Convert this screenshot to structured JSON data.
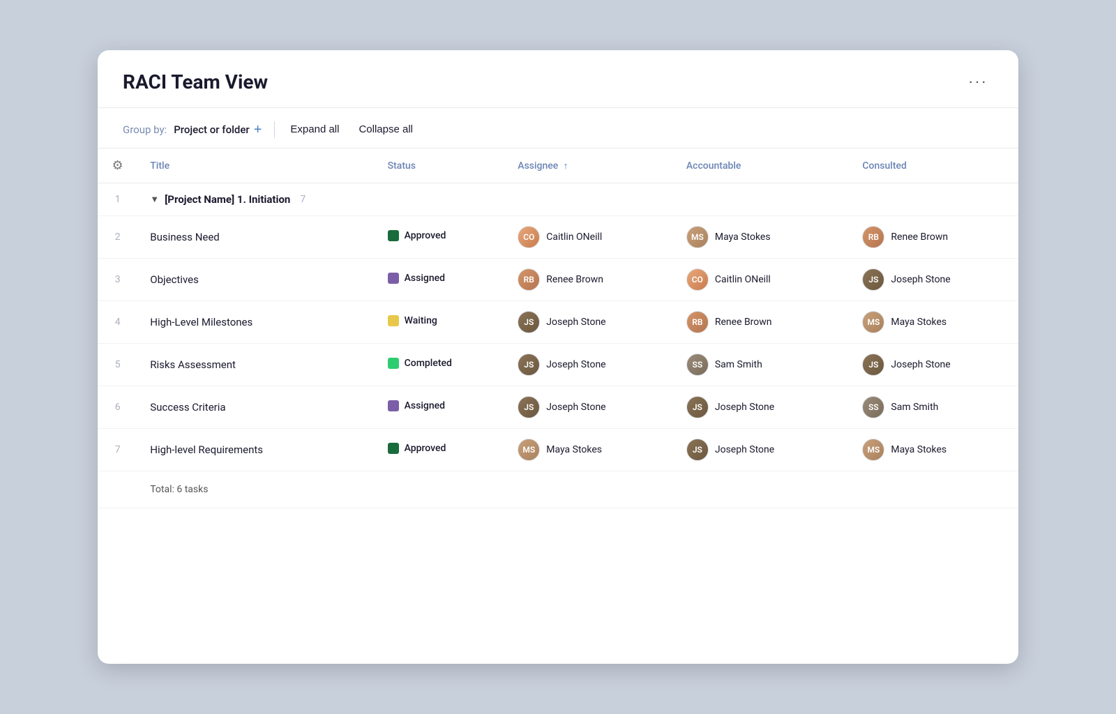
{
  "header": {
    "title": "RACI Team View",
    "more_label": "···"
  },
  "toolbar": {
    "group_by_label": "Group by:",
    "group_by_value": "Project or folder",
    "add_icon": "+",
    "expand_all": "Expand all",
    "collapse_all": "Collapse all"
  },
  "columns": {
    "title": "Title",
    "status": "Status",
    "assignee": "Assignee",
    "accountable": "Accountable",
    "consulted": "Consulted"
  },
  "group": {
    "label": "[Project Name] 1. Initiation",
    "count": "7",
    "chevron": "▼"
  },
  "rows": [
    {
      "num": "2",
      "title": "Business Need",
      "status_label": "Approved",
      "status_class": "dot-approved",
      "assignee": "Caitlin ONeill",
      "assignee_class": "av-caitlin",
      "assignee_initials": "CO",
      "accountable": "Maya Stokes",
      "accountable_class": "av-maya",
      "accountable_initials": "MS",
      "consulted": "Renee Brown",
      "consulted_class": "av-renee",
      "consulted_initials": "RB"
    },
    {
      "num": "3",
      "title": "Objectives",
      "status_label": "Assigned",
      "status_class": "dot-assigned",
      "assignee": "Renee Brown",
      "assignee_class": "av-renee",
      "assignee_initials": "RB",
      "accountable": "Caitlin ONeill",
      "accountable_class": "av-caitlin",
      "accountable_initials": "CO",
      "consulted": "Joseph Stone",
      "consulted_class": "av-joseph",
      "consulted_initials": "JS"
    },
    {
      "num": "4",
      "title": "High-Level Milestones",
      "status_label": "Waiting",
      "status_class": "dot-waiting",
      "assignee": "Joseph Stone",
      "assignee_class": "av-joseph",
      "assignee_initials": "JS",
      "accountable": "Renee Brown",
      "accountable_class": "av-renee",
      "accountable_initials": "RB",
      "consulted": "Maya Stokes",
      "consulted_class": "av-maya",
      "consulted_initials": "MS"
    },
    {
      "num": "5",
      "title": "Risks Assessment",
      "status_label": "Completed",
      "status_class": "dot-completed",
      "assignee": "Joseph Stone",
      "assignee_class": "av-joseph",
      "assignee_initials": "JS",
      "accountable": "Sam Smith",
      "accountable_class": "av-sam",
      "accountable_initials": "SS",
      "consulted": "Joseph Stone",
      "consulted_class": "av-joseph",
      "consulted_initials": "JS"
    },
    {
      "num": "6",
      "title": "Success Criteria",
      "status_label": "Assigned",
      "status_class": "dot-assigned",
      "assignee": "Joseph Stone",
      "assignee_class": "av-joseph",
      "assignee_initials": "JS",
      "accountable": "Joseph Stone",
      "accountable_class": "av-joseph",
      "accountable_initials": "JS",
      "consulted": "Sam Smith",
      "consulted_class": "av-sam",
      "consulted_initials": "SS"
    },
    {
      "num": "7",
      "title": "High-level Requirements",
      "status_label": "Approved",
      "status_class": "dot-approved",
      "assignee": "Maya Stokes",
      "assignee_class": "av-maya",
      "assignee_initials": "MS",
      "accountable": "Joseph Stone",
      "accountable_class": "av-joseph",
      "accountable_initials": "JS",
      "consulted": "Maya Stokes",
      "consulted_class": "av-maya",
      "consulted_initials": "MS"
    }
  ],
  "total": "Total: 6 tasks"
}
